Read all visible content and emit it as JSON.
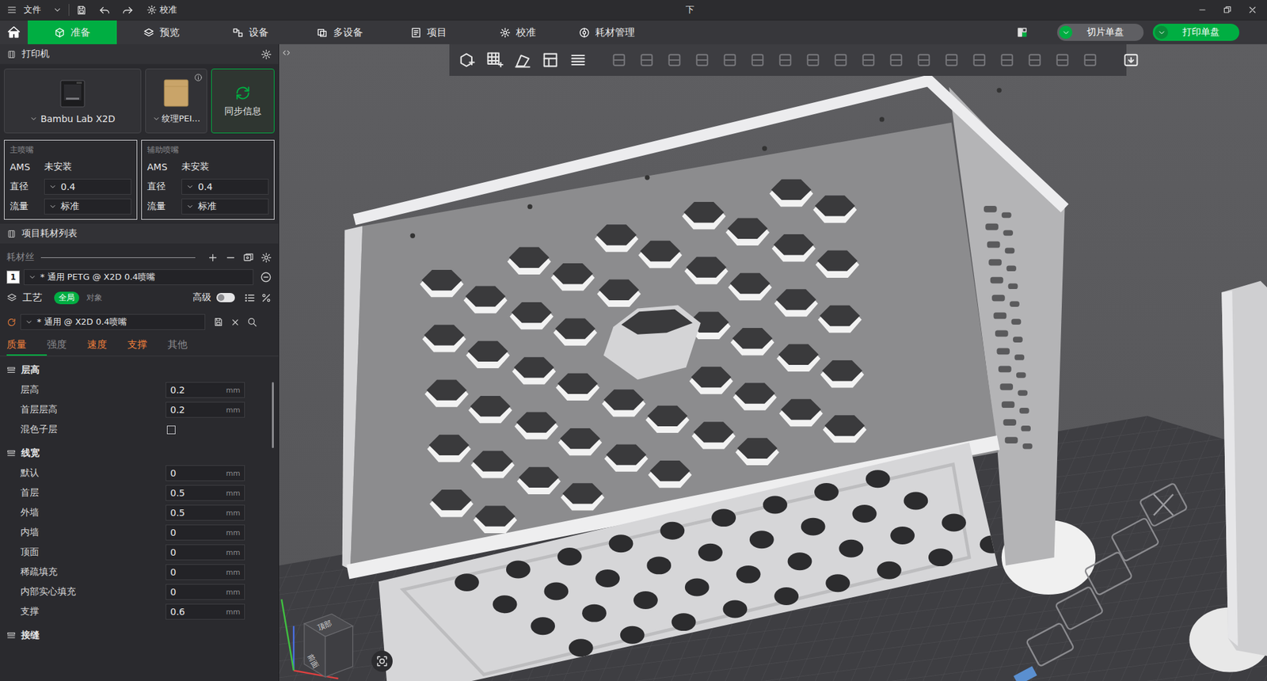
{
  "titlebar": {
    "menu": "文件",
    "calibrate": "校准",
    "title": "下"
  },
  "nav": {
    "tabs": [
      {
        "label": "准备",
        "selected": true
      },
      {
        "label": "预览",
        "selected": false
      },
      {
        "label": "设备",
        "selected": false
      },
      {
        "label": "多设备",
        "selected": false
      },
      {
        "label": "项目",
        "selected": false
      },
      {
        "label": "校准",
        "selected": false
      },
      {
        "label": "耗材管理",
        "selected": false
      }
    ],
    "slice_button": "切片单盘",
    "print_button": "打印单盘"
  },
  "printer": {
    "title": "打印机",
    "model": "Bambu Lab X2D",
    "plate": "纹理PEI...",
    "sync": "同步信息"
  },
  "nozzles": [
    {
      "title": "主喷嘴",
      "rows": [
        {
          "label": "AMS",
          "value": "未安装",
          "kind": "text"
        },
        {
          "label": "直径",
          "value": "0.4",
          "kind": "select"
        },
        {
          "label": "流量",
          "value": "标准",
          "kind": "select"
        }
      ]
    },
    {
      "title": "辅助喷嘴",
      "rows": [
        {
          "label": "AMS",
          "value": "未安装",
          "kind": "text"
        },
        {
          "label": "直径",
          "value": "0.4",
          "kind": "select"
        },
        {
          "label": "流量",
          "value": "标准",
          "kind": "select"
        }
      ]
    }
  ],
  "filaments": {
    "title": "项目耗材列表",
    "label": "耗材丝",
    "items": [
      {
        "index": "1",
        "name": "* 通用 PETG @ X2D 0.4喷嘴",
        "color": "#ffffff"
      }
    ]
  },
  "process": {
    "title": "工艺",
    "scopes": [
      {
        "label": "全局",
        "selected": true
      },
      {
        "label": "对象",
        "selected": false
      }
    ],
    "advanced_label": "高级",
    "advanced": false,
    "preset": "* 通用 @ X2D 0.4喷嘴",
    "tabs": [
      {
        "label": "质量",
        "selected": true,
        "modified": true
      },
      {
        "label": "强度",
        "selected": false,
        "modified": false
      },
      {
        "label": "速度",
        "selected": false,
        "modified": true
      },
      {
        "label": "支撑",
        "selected": false,
        "modified": true
      },
      {
        "label": "其他",
        "selected": false,
        "modified": false
      }
    ]
  },
  "sections": [
    {
      "title": "层高",
      "rows": [
        {
          "label": "层高",
          "kind": "number",
          "value": "0.2",
          "unit": "mm"
        },
        {
          "label": "首层层高",
          "kind": "number",
          "value": "0.2",
          "unit": "mm"
        },
        {
          "label": "混色子层",
          "kind": "checkbox",
          "checked": false
        }
      ]
    },
    {
      "title": "线宽",
      "rows": [
        {
          "label": "默认",
          "kind": "number",
          "value": "0",
          "unit": "mm"
        },
        {
          "label": "首层",
          "kind": "number",
          "value": "0.5",
          "unit": "mm"
        },
        {
          "label": "外墙",
          "kind": "number",
          "value": "0.5",
          "unit": "mm"
        },
        {
          "label": "内墙",
          "kind": "number",
          "value": "0",
          "unit": "mm"
        },
        {
          "label": "顶面",
          "kind": "number",
          "value": "0",
          "unit": "mm"
        },
        {
          "label": "稀疏填充",
          "kind": "number",
          "value": "0",
          "unit": "mm"
        },
        {
          "label": "内部实心填充",
          "kind": "number",
          "value": "0",
          "unit": "mm"
        },
        {
          "label": "支撑",
          "kind": "number",
          "value": "0.6",
          "unit": "mm"
        }
      ]
    },
    {
      "title": "接缝",
      "rows": []
    }
  ],
  "viewport": {
    "cube_labels": [
      "顶部",
      "前面"
    ]
  }
}
